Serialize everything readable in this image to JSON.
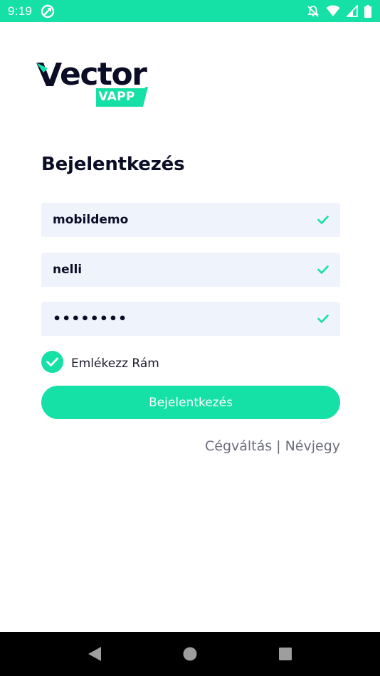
{
  "status_bar": {
    "time": "9:19",
    "colors": {
      "background": "#15e0a6",
      "foreground": "#ffffff"
    },
    "icons": [
      "sync-icon",
      "notifications-off-icon",
      "wifi-icon",
      "signal-icon",
      "battery-icon"
    ]
  },
  "logo": {
    "word_rest": "ector",
    "badge": "VAPP",
    "colors": {
      "word": "#0b0d26",
      "accent": "#15e0a6"
    }
  },
  "login": {
    "title": "Bejelentkezés",
    "fields": [
      {
        "value": "mobildemo",
        "valid": true
      },
      {
        "value": "nelli",
        "valid": true
      },
      {
        "value": "••••••••",
        "valid": true
      }
    ],
    "remember_label": "Emlékezz Rám",
    "remember_checked": true,
    "submit_label": "Bejelentkezés"
  },
  "links": {
    "switch_company": "Cégváltás",
    "separator": "|",
    "about": "Névjegy"
  },
  "nav_bar": {
    "icons": [
      "back-icon",
      "home-icon",
      "recents-icon"
    ]
  },
  "colors": {
    "accent": "#15e0a6",
    "field_background": "#eff3fc",
    "text_dark": "#0b0d26",
    "link_gray": "#6b6d7c"
  }
}
